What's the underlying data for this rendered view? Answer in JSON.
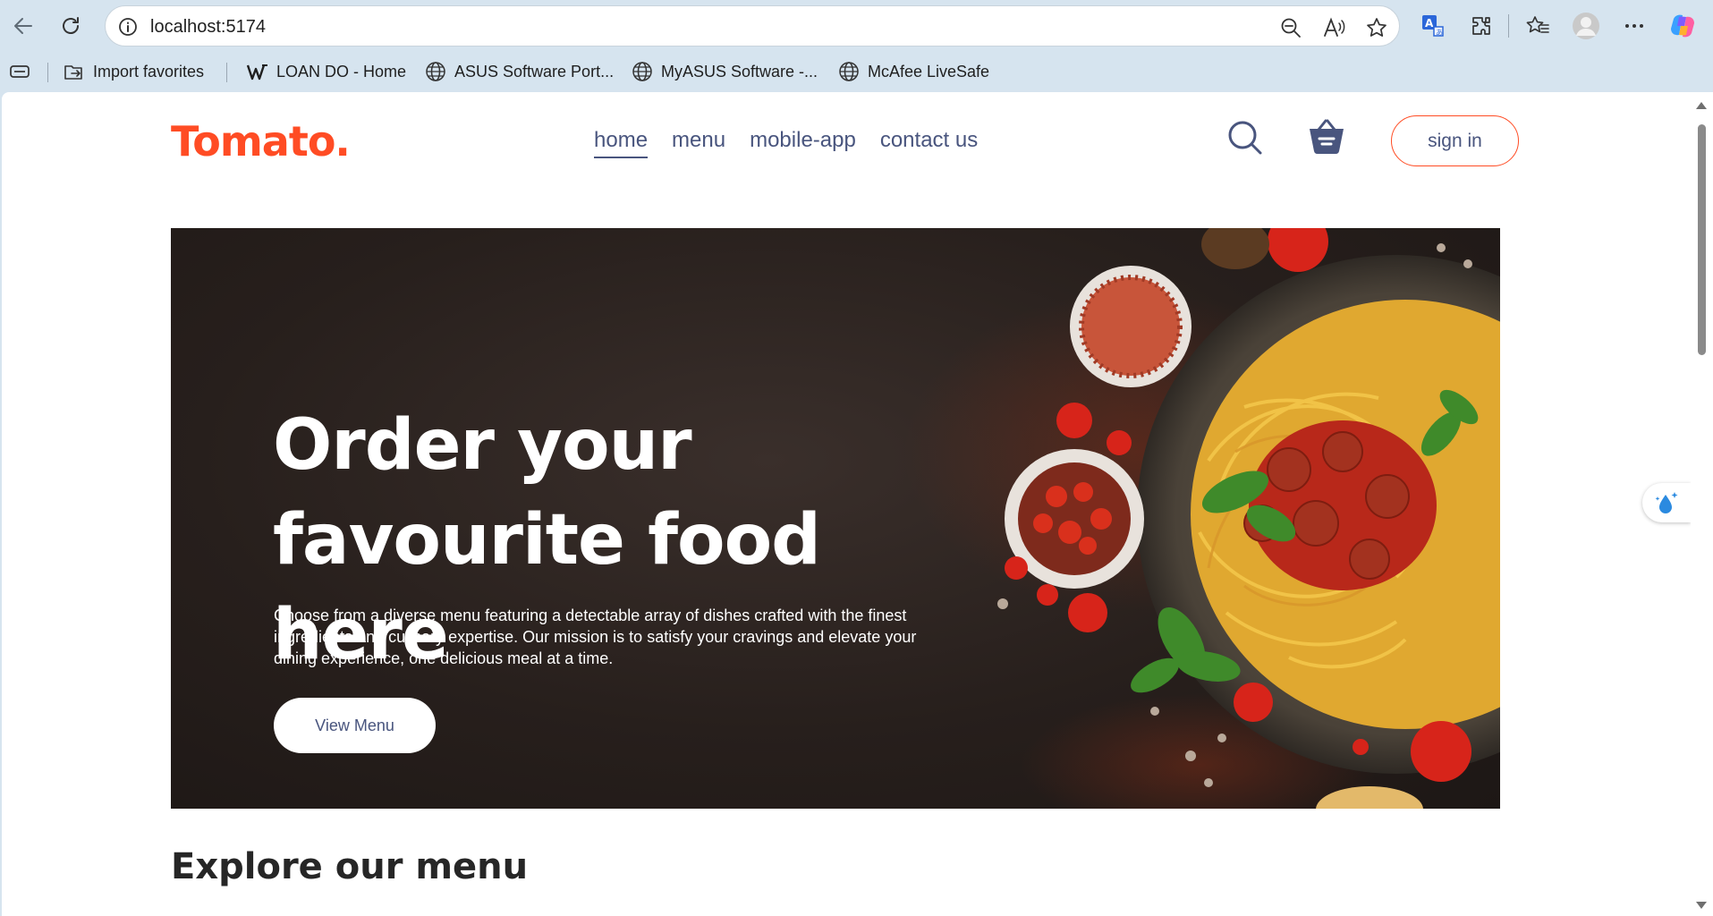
{
  "browser": {
    "url": "localhost:5174",
    "icons": [
      "back-icon",
      "refresh-icon",
      "info-icon",
      "zoom-out-icon",
      "read-aloud-icon",
      "favorite-star-icon",
      "translate-icon",
      "extensions-icon",
      "favorites-icon",
      "profile-icon",
      "more-icon",
      "copilot-icon"
    ],
    "bookmarks": [
      {
        "label": "Import favorites",
        "icon": "import-icon"
      },
      {
        "label": "LOAN DO - Home",
        "icon": "w-logo-icon"
      },
      {
        "label": "ASUS Software Port...",
        "icon": "globe-icon"
      },
      {
        "label": "MyASUS Software -...",
        "icon": "globe-icon"
      },
      {
        "label": "McAfee LiveSafe",
        "icon": "globe-icon"
      }
    ]
  },
  "site": {
    "logo": "Tomato.",
    "nav": [
      "home",
      "menu",
      "mobile-app",
      "contact us"
    ],
    "active_nav": "home",
    "sign_in": "sign in",
    "hero": {
      "title_line1": "Order your",
      "title_line2": "favourite food here",
      "description": "Choose from a diverse menu featuring a detectable array of dishes crafted with the finest ingredients and culinary expertise. Our mission is to satisfy your cravings and elevate your dining experience, one delicious meal at a time.",
      "button": "View Menu"
    },
    "section_title": "Explore our menu"
  },
  "colors": {
    "brand": "#ff4c24",
    "nav_text": "#49557e",
    "hero_bg": "#271f1c"
  }
}
